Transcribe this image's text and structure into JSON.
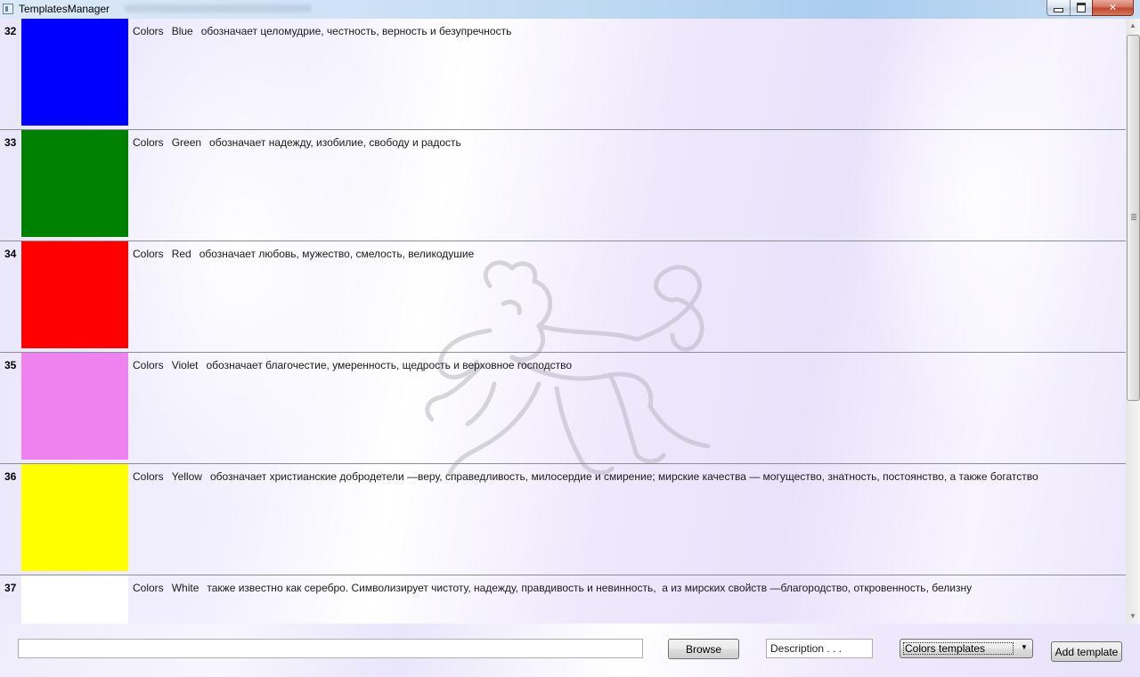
{
  "window": {
    "title": "TemplatesManager",
    "icon": "app-window-icon"
  },
  "templates": [
    {
      "number": "32",
      "category": "Colors",
      "name": "Blue",
      "description": "обозначает целомудрие, честность, верность и безупречность",
      "color": "#0000FF"
    },
    {
      "number": "33",
      "category": "Colors",
      "name": "Green",
      "description": "обозначает надежду, изобилие, свободу и радость",
      "color": "#008000"
    },
    {
      "number": "34",
      "category": "Colors",
      "name": "Red",
      "description": "обозначает любовь, мужество, смелость, великодушие",
      "color": "#FF0000"
    },
    {
      "number": "35",
      "category": "Colors",
      "name": "Violet",
      "description": "обозначает благочестие, умеренность, щедрость и верховное господство",
      "color": "#EE82EE"
    },
    {
      "number": "36",
      "category": "Colors",
      "name": "Yellow",
      "description": "обозначает христианские добродетели —веру, справедливость, милосердие и смирение; мирские качества — могущество, знатность, постоянство, а также богатство",
      "color": "#FFFF00"
    },
    {
      "number": "37",
      "category": "Colors",
      "name": "White",
      "description": "также известно как серебро. Символизирует чистоту, надежду, правдивость и невинность,  а из мирских свойств —благородство, откровенность, белизну",
      "color": "#FFFFFF"
    }
  ],
  "bottom_bar": {
    "path_value": "",
    "browse_label": "Browse",
    "description_placeholder": "Description . . .",
    "template_type_selected": "Colors templates",
    "add_label": "Add template"
  },
  "watermark": "heraldic-lion-watermark"
}
